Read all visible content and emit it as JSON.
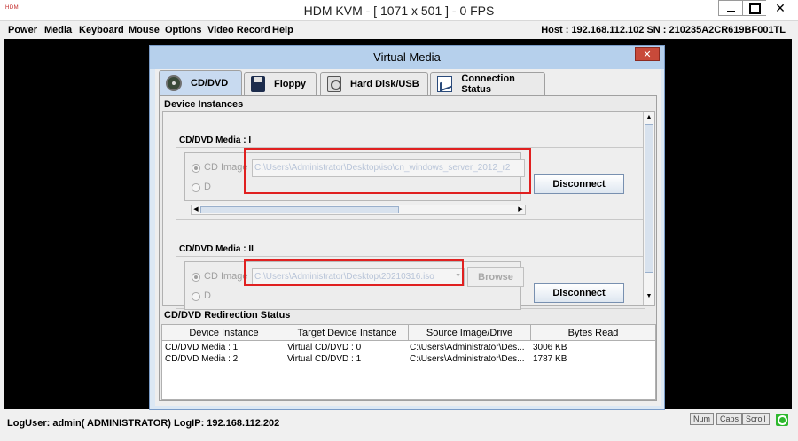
{
  "window": {
    "logo": "HDM",
    "title": "HDM KVM - [ 1071 x 501 ] - 0 FPS",
    "close_glyph": "✕"
  },
  "menu": {
    "items": [
      "Power",
      "Media",
      "Keyboard",
      "Mouse",
      "Options",
      "Video Record",
      "Help"
    ],
    "host_info": "Host : 192.168.112.102   SN : 210235A2CR619BF001TL"
  },
  "status_bar": {
    "log_info": "LogUser: admin( ADMINISTRATOR)   LogIP: 192.168.112.202",
    "keys": [
      "Num",
      "Caps",
      "Scroll"
    ]
  },
  "dialog": {
    "title": "Virtual Media",
    "close_glyph": "✕",
    "tabs": [
      {
        "label": "CD/DVD",
        "icon": "cd-icon",
        "selected": true
      },
      {
        "label": "Floppy",
        "icon": "floppy-icon",
        "selected": false
      },
      {
        "label": "Hard Disk/USB",
        "icon": "hard-disk-icon",
        "selected": false
      },
      {
        "label": "Connection Status",
        "icon": "chart-icon",
        "selected": false
      }
    ],
    "device_instances_label": "Device Instances",
    "media1": {
      "label": "CD/DVD Media : I",
      "option1": "CD Image",
      "option2": "D",
      "path": "C:\\Users\\Administrator\\Desktop\\iso\\cn_windows_server_2012_r2",
      "button": "Disconnect"
    },
    "media2": {
      "label": "CD/DVD Media : II",
      "option1": "CD Image",
      "option2": "D",
      "path": "C:\\Users\\Administrator\\Desktop\\20210316.iso",
      "browse": "Browse",
      "button": "Disconnect"
    },
    "redirection_status_label": "CD/DVD Redirection Status",
    "table": {
      "columns": [
        "Device Instance",
        "Target Device Instance",
        "Source Image/Drive",
        "Bytes Read"
      ],
      "rows": [
        [
          "CD/DVD Media :  1",
          "Virtual CD/DVD : 0",
          "C:\\Users\\Administrator\\Des...",
          "3006 KB"
        ],
        [
          "CD/DVD Media :  2",
          "Virtual CD/DVD : 1",
          "C:\\Users\\Administrator\\Des...",
          "1787 KB"
        ]
      ]
    },
    "accent_red": "#e02020"
  }
}
